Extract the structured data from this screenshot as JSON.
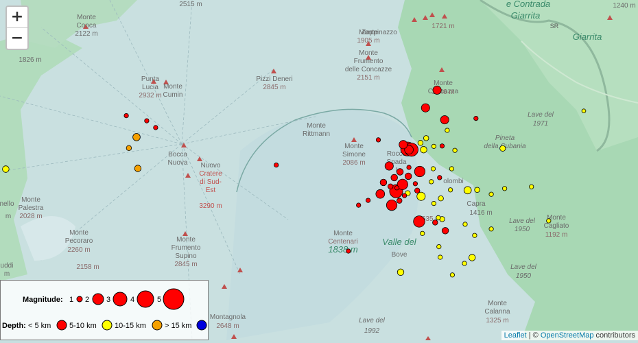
{
  "zoom": {
    "in_label": "+",
    "out_label": "−"
  },
  "legend": {
    "magnitude_title": "Magnitude:",
    "magnitudes": [
      "1",
      "2",
      "3",
      "4",
      "5"
    ],
    "depth_title": "Depth:",
    "depths": [
      {
        "label": "< 5 km",
        "color": "#ff0000"
      },
      {
        "label": "5-10 km",
        "color": "#ffff00"
      },
      {
        "label": "10-15 km",
        "color": "#f5a000"
      },
      {
        "label": "> 15 km",
        "color": "#0000dd"
      }
    ]
  },
  "attribution": {
    "leaflet": "Leaflet",
    "sep": " | © ",
    "osm": "OpenStreetMap",
    "rest": " contributors"
  },
  "labels": [
    {
      "t": "2515 m"
    },
    {
      "t": "Monte"
    },
    {
      "t": "Conca"
    },
    {
      "t": "2122 m"
    },
    {
      "t": "1826 m"
    },
    {
      "t": "Punta"
    },
    {
      "t": "Lucia"
    },
    {
      "t": "2932 m"
    },
    {
      "t": "Monte"
    },
    {
      "t": "Cumin"
    },
    {
      "t": "Pizzi Deneri"
    },
    {
      "t": "2845 m"
    },
    {
      "t": "Monte"
    },
    {
      "t": "Zappinazzo"
    },
    {
      "t": "1905 m"
    },
    {
      "t": "Monte"
    },
    {
      "t": "Frumento"
    },
    {
      "t": "delle Concazze"
    },
    {
      "t": "2151 m"
    },
    {
      "t": "1721 m"
    },
    {
      "t": "e Contrada"
    },
    {
      "t": "Giarrita"
    },
    {
      "t": "Giarrita"
    },
    {
      "t": "1240 m"
    },
    {
      "t": "Monte"
    },
    {
      "t": "Concazza"
    },
    {
      "t": "1746 m"
    },
    {
      "t": "Lave del"
    },
    {
      "t": "1971"
    },
    {
      "t": "Pineta"
    },
    {
      "t": "della Cubania"
    },
    {
      "t": "Monte"
    },
    {
      "t": "Rittmann"
    },
    {
      "t": "Monte"
    },
    {
      "t": "Simone"
    },
    {
      "t": "2086 m"
    },
    {
      "t": "Rocca"
    },
    {
      "t": "Spada"
    },
    {
      "t": "I"
    },
    {
      "t": "Bocca"
    },
    {
      "t": "Nuova"
    },
    {
      "t": "Nuovo"
    },
    {
      "t": "Cratere"
    },
    {
      "t": "di Sud-"
    },
    {
      "t": "Est"
    },
    {
      "t": "3290 m"
    },
    {
      "t": "Monte"
    },
    {
      "t": "Palestra"
    },
    {
      "t": "2028 m"
    },
    {
      "t": "nello"
    },
    {
      "t": "m"
    },
    {
      "t": "Monte"
    },
    {
      "t": "Pecoraro"
    },
    {
      "t": "2260 m"
    },
    {
      "t": "2158 m"
    },
    {
      "t": "uddi"
    },
    {
      "t": "m"
    },
    {
      "t": "Monte"
    },
    {
      "t": "Frumento"
    },
    {
      "t": "Supino"
    },
    {
      "t": "2845 m"
    },
    {
      "t": "Monte"
    },
    {
      "t": "Centenari"
    },
    {
      "t": "1838 m"
    },
    {
      "t": "Valle del"
    },
    {
      "t": "Bove"
    },
    {
      "t": "olombi"
    },
    {
      "t": "Capra"
    },
    {
      "t": "1416 m"
    },
    {
      "t": "1635 m"
    },
    {
      "t": "Lave del"
    },
    {
      "t": "1950"
    },
    {
      "t": "Monte"
    },
    {
      "t": "Cagliato"
    },
    {
      "t": "1192 m"
    },
    {
      "t": "Lave del"
    },
    {
      "t": "1950"
    },
    {
      "t": "Monte"
    },
    {
      "t": "Calanna"
    },
    {
      "t": "1325 m"
    },
    {
      "t": "Lave del"
    },
    {
      "t": "1992"
    },
    {
      "t": "Montagnola"
    },
    {
      "t": "2648 m"
    },
    {
      "t": "SR"
    }
  ],
  "quakes": [
    {
      "lon": 0.198,
      "lat": 0.66,
      "mag": 1.0,
      "depth": "<5"
    },
    {
      "lon": 0.23,
      "lat": 0.645,
      "mag": 1.0,
      "depth": "<5"
    },
    {
      "lon": 0.244,
      "lat": 0.625,
      "mag": 1.0,
      "depth": "<5"
    },
    {
      "lon": 0.214,
      "lat": 0.597,
      "mag": 1.7,
      "depth": "10-15"
    },
    {
      "lon": 0.202,
      "lat": 0.565,
      "mag": 1.2,
      "depth": "10-15"
    },
    {
      "lon": 0.216,
      "lat": 0.505,
      "mag": 1.5,
      "depth": "10-15"
    },
    {
      "lon": 0.009,
      "lat": 0.503,
      "mag": 1.5,
      "depth": "5-10"
    },
    {
      "lon": 0.433,
      "lat": 0.515,
      "mag": 1.0,
      "depth": "<5"
    },
    {
      "lon": 0.685,
      "lat": 0.735,
      "mag": 1.9,
      "depth": "<5"
    },
    {
      "lon": 0.667,
      "lat": 0.683,
      "mag": 1.9,
      "depth": "<5"
    },
    {
      "lon": 0.697,
      "lat": 0.648,
      "mag": 1.9,
      "depth": "<5"
    },
    {
      "lon": 0.746,
      "lat": 0.652,
      "mag": 1.0,
      "depth": "<5"
    },
    {
      "lon": 0.915,
      "lat": 0.674,
      "mag": 0.9,
      "depth": "5-10"
    },
    {
      "lon": 0.701,
      "lat": 0.617,
      "mag": 1.0,
      "depth": "5-10"
    },
    {
      "lon": 0.593,
      "lat": 0.589,
      "mag": 1.0,
      "depth": "<5"
    },
    {
      "lon": 0.645,
      "lat": 0.56,
      "mag": 3.0,
      "depth": "<5"
    },
    {
      "lon": 0.641,
      "lat": 0.56,
      "mag": 2.0,
      "depth": "<5"
    },
    {
      "lon": 0.659,
      "lat": 0.58,
      "mag": 1.2,
      "depth": "5-10"
    },
    {
      "lon": 0.668,
      "lat": 0.594,
      "mag": 1.2,
      "depth": "5-10"
    },
    {
      "lon": 0.664,
      "lat": 0.56,
      "mag": 1.5,
      "depth": "5-10"
    },
    {
      "lon": 0.68,
      "lat": 0.57,
      "mag": 1.0,
      "depth": "5-10"
    },
    {
      "lon": 0.693,
      "lat": 0.571,
      "mag": 1.0,
      "depth": "<5"
    },
    {
      "lon": 0.713,
      "lat": 0.558,
      "mag": 1.0,
      "depth": "5-10"
    },
    {
      "lon": 0.788,
      "lat": 0.564,
      "mag": 1.3,
      "depth": "5-10"
    },
    {
      "lon": 0.61,
      "lat": 0.512,
      "mag": 1.9,
      "depth": "<5"
    },
    {
      "lon": 0.627,
      "lat": 0.495,
      "mag": 1.5,
      "depth": "<5"
    },
    {
      "lon": 0.641,
      "lat": 0.508,
      "mag": 1.0,
      "depth": "<5"
    },
    {
      "lon": 0.658,
      "lat": 0.496,
      "mag": 2.4,
      "depth": "<5"
    },
    {
      "lon": 0.679,
      "lat": 0.504,
      "mag": 1.0,
      "depth": "5-10"
    },
    {
      "lon": 0.708,
      "lat": 0.504,
      "mag": 1.0,
      "depth": "5-10"
    },
    {
      "lon": 0.618,
      "lat": 0.478,
      "mag": 1.5,
      "depth": "<5"
    },
    {
      "lon": 0.601,
      "lat": 0.464,
      "mag": 1.5,
      "depth": "<5"
    },
    {
      "lon": 0.612,
      "lat": 0.452,
      "mag": 1.2,
      "depth": "<5"
    },
    {
      "lon": 0.631,
      "lat": 0.458,
      "mag": 2.4,
      "depth": "<5"
    },
    {
      "lon": 0.622,
      "lat": 0.448,
      "mag": 1.0,
      "depth": "<5"
    },
    {
      "lon": 0.651,
      "lat": 0.46,
      "mag": 1.0,
      "depth": "<5"
    },
    {
      "lon": 0.689,
      "lat": 0.478,
      "mag": 1.0,
      "depth": "<5"
    },
    {
      "lon": 0.676,
      "lat": 0.466,
      "mag": 1.0,
      "depth": "5-10"
    },
    {
      "lon": 0.596,
      "lat": 0.43,
      "mag": 2.0,
      "depth": "<5"
    },
    {
      "lon": 0.614,
      "lat": 0.397,
      "mag": 2.4,
      "depth": "<5"
    },
    {
      "lon": 0.634,
      "lat": 0.425,
      "mag": 1.0,
      "depth": "<5"
    },
    {
      "lon": 0.626,
      "lat": 0.41,
      "mag": 1.2,
      "depth": "<5"
    },
    {
      "lon": 0.639,
      "lat": 0.432,
      "mag": 1.2,
      "depth": "5-10"
    },
    {
      "lon": 0.66,
      "lat": 0.423,
      "mag": 1.9,
      "depth": "5-10"
    },
    {
      "lon": 0.68,
      "lat": 0.402,
      "mag": 1.0,
      "depth": "5-10"
    },
    {
      "lon": 0.691,
      "lat": 0.417,
      "mag": 1.2,
      "depth": "5-10"
    },
    {
      "lon": 0.706,
      "lat": 0.442,
      "mag": 1.0,
      "depth": "5-10"
    },
    {
      "lon": 0.733,
      "lat": 0.441,
      "mag": 1.7,
      "depth": "5-10"
    },
    {
      "lon": 0.748,
      "lat": 0.442,
      "mag": 1.2,
      "depth": "5-10"
    },
    {
      "lon": 0.77,
      "lat": 0.429,
      "mag": 1.0,
      "depth": "5-10"
    },
    {
      "lon": 0.791,
      "lat": 0.446,
      "mag": 1.0,
      "depth": "5-10"
    },
    {
      "lon": 0.833,
      "lat": 0.451,
      "mag": 1.0,
      "depth": "5-10"
    },
    {
      "lon": 0.562,
      "lat": 0.397,
      "mag": 1.0,
      "depth": "<5"
    },
    {
      "lon": 0.577,
      "lat": 0.411,
      "mag": 1.0,
      "depth": "<5"
    },
    {
      "lon": 0.657,
      "lat": 0.349,
      "mag": 2.6,
      "depth": "<5"
    },
    {
      "lon": 0.693,
      "lat": 0.356,
      "mag": 1.2,
      "depth": "5-10"
    },
    {
      "lon": 0.682,
      "lat": 0.346,
      "mag": 1.2,
      "depth": "<5"
    },
    {
      "lon": 0.687,
      "lat": 0.36,
      "mag": 1.0,
      "depth": "5-10"
    },
    {
      "lon": 0.729,
      "lat": 0.341,
      "mag": 1.0,
      "depth": "5-10"
    },
    {
      "lon": 0.698,
      "lat": 0.322,
      "mag": 1.5,
      "depth": "<5"
    },
    {
      "lon": 0.744,
      "lat": 0.308,
      "mag": 1.0,
      "depth": "5-10"
    },
    {
      "lon": 0.77,
      "lat": 0.327,
      "mag": 1.0,
      "depth": "5-10"
    },
    {
      "lon": 0.86,
      "lat": 0.351,
      "mag": 1.0,
      "depth": "5-10"
    },
    {
      "lon": 0.546,
      "lat": 0.262,
      "mag": 1.0,
      "depth": "<5"
    },
    {
      "lon": 0.662,
      "lat": 0.314,
      "mag": 1.0,
      "depth": "5-10"
    },
    {
      "lon": 0.688,
      "lat": 0.275,
      "mag": 1.0,
      "depth": "5-10"
    },
    {
      "lon": 0.69,
      "lat": 0.244,
      "mag": 1.0,
      "depth": "5-10"
    },
    {
      "lon": 0.728,
      "lat": 0.226,
      "mag": 1.0,
      "depth": "5-10"
    },
    {
      "lon": 0.74,
      "lat": 0.243,
      "mag": 1.5,
      "depth": "5-10"
    },
    {
      "lon": 0.628,
      "lat": 0.2,
      "mag": 1.5,
      "depth": "5-10"
    },
    {
      "lon": 0.709,
      "lat": 0.192,
      "mag": 1.0,
      "depth": "5-10"
    },
    {
      "lon": 0.639,
      "lat": 0.562,
      "mag": 3.2,
      "depth": "<5"
    },
    {
      "lon": 0.632,
      "lat": 0.575,
      "mag": 1.9,
      "depth": "<5"
    },
    {
      "lon": 0.621,
      "lat": 0.438,
      "mag": 3.0,
      "depth": "<5"
    },
    {
      "lon": 0.64,
      "lat": 0.482,
      "mag": 1.5,
      "depth": "<5"
    },
    {
      "lon": 0.654,
      "lat": 0.44,
      "mag": 1.2,
      "depth": "<5"
    }
  ]
}
